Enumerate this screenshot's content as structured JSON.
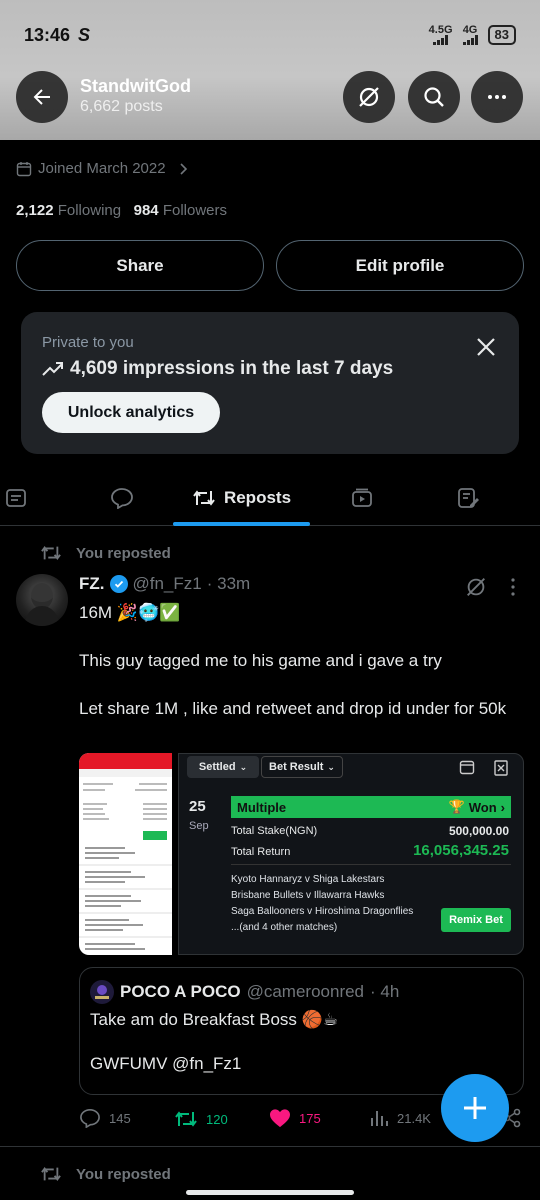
{
  "status": {
    "time": "13:46",
    "carrier_glyph": "S",
    "net1": "4.5G",
    "net2": "4G",
    "battery": "83"
  },
  "header": {
    "title": "StandwitGod",
    "posts": "6,662 posts"
  },
  "profile": {
    "joined": "Joined March 2022",
    "following_count": "2,122",
    "following_label": "Following",
    "followers_count": "984",
    "followers_label": "Followers",
    "share_label": "Share",
    "edit_label": "Edit profile"
  },
  "analytics": {
    "private": "Private to you",
    "impressions": "4,609 impressions in the last 7 days",
    "unlock": "Unlock analytics"
  },
  "tabs": {
    "reposts": "Reposts"
  },
  "post": {
    "reposted": "You reposted",
    "name": "FZ.",
    "handle": "@fn_Fz1",
    "time": "· 33m",
    "line1": "16M 🎉🥶✅",
    "line2": "This guy tagged me to his game and i gave a try",
    "line3": "Let share 1M , like and retweet and drop id under for 50k",
    "bet": {
      "settled": "Settled",
      "bet_result": "Bet Result",
      "day": "25",
      "month": "Sep",
      "multiple": "Multiple",
      "won": "Won",
      "stake_label": "Total Stake(NGN)",
      "stake": "500,000.00",
      "return_label": "Total Return",
      "return": "16,056,345.25",
      "m1": "Kyoto Hannaryz v Shiga Lakestars",
      "m2": "Brisbane Bullets v Illawarra Hawks",
      "m3": "Saga Ballooners v Hiroshima Dragonflies",
      "m4": "...(and 4 other matches)",
      "remix": "Remix Bet"
    },
    "quote": {
      "name": "POCO A POCO",
      "handle": "@cameroonred",
      "time": "· 4h",
      "text1": "Take am do Breakfast Boss 🏀☕",
      "text2": "GWFUMV @fn_Fz1"
    },
    "actions": {
      "replies": "145",
      "reposts": "120",
      "likes": "175",
      "views": "21.4K"
    }
  },
  "next": {
    "reposted": "You reposted"
  },
  "colors": {
    "accent": "#1d9bf0",
    "repost_green": "#00ba7c",
    "like_pink": "#f91880",
    "bet_green": "#1db954"
  }
}
